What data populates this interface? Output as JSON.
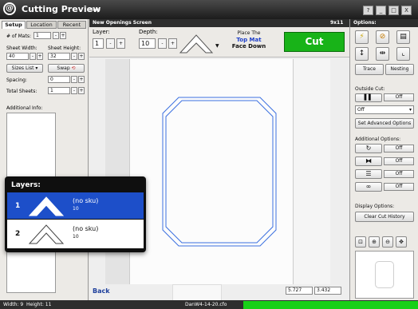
{
  "app": {
    "title": "Cutting Preview",
    "help": "Help",
    "logo": "@"
  },
  "window_buttons": [
    "?",
    "_",
    "□",
    "X"
  ],
  "tabs": [
    "Setup",
    "Location",
    "Recent"
  ],
  "left": {
    "mats_label": "# of Mats:",
    "mats_value": "1",
    "sheet_width_label": "Sheet Width:",
    "sheet_width": "40",
    "sheet_height_label": "Sheet Height:",
    "sheet_height": "32",
    "sizes_list": "Sizes List",
    "swap": "Swap",
    "spacing_label": "Spacing:",
    "spacing": "0",
    "total_sheets_label": "Total Sheets:",
    "total_sheets": "1",
    "additional_info_label": "Additional Info:"
  },
  "center": {
    "screen_title": "New Openings Screen",
    "size_label": "9x11",
    "layer_label": "Layer:",
    "layer_value": "1",
    "depth_label": "Depth:",
    "depth_value": "10",
    "place_line1": "Place The",
    "place_top": "Top",
    "place_mat": "Mat",
    "place_line3": "Face Down",
    "cut": "Cut",
    "back": "Back",
    "coord_x": "5.727",
    "coord_y": "3.432"
  },
  "layers_popup": {
    "title": "Layers:",
    "rows": [
      {
        "num": "1",
        "sku": "(no sku)",
        "depth": "10"
      },
      {
        "num": "2",
        "sku": "(no sku)",
        "depth": "10"
      }
    ]
  },
  "right": {
    "options": "Options:",
    "trace": "Trace",
    "nesting": "Nesting",
    "outside_cut": "Outside Cut:",
    "off": "Off",
    "select_off": "Off",
    "set_advanced": "Set Advanced Options",
    "additional_options": "Additional Options:",
    "display_options": "Display Options:",
    "clear_history": "Clear Cut History"
  },
  "status": {
    "size": "Width: 9  Height: 11",
    "file": "DanW4-14-20.cfo"
  },
  "colors": {
    "cut_green": "#18b318",
    "layer_blue": "#1d4fc9",
    "cut_path": "#3b6fe0"
  }
}
